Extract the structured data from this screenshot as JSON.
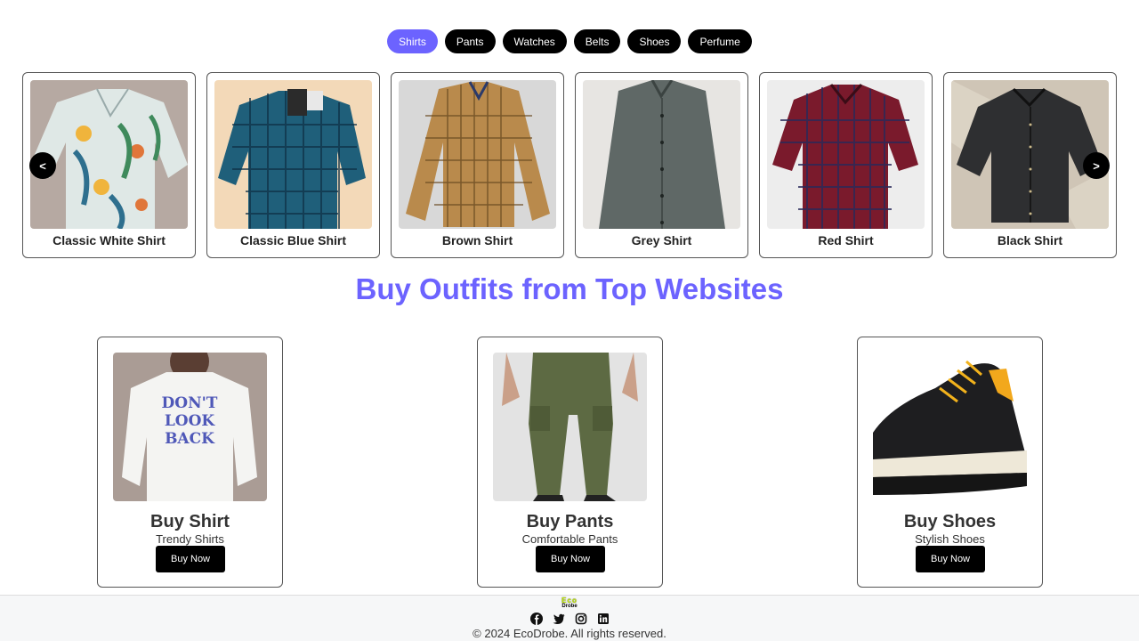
{
  "categories": {
    "items": [
      "Shirts",
      "Pants",
      "Watches",
      "Belts",
      "Shoes",
      "Perfume"
    ],
    "active": "Shirts"
  },
  "carousel": {
    "prev_label": "<",
    "next_label": ">",
    "items": [
      {
        "name": "Classic White Shirt"
      },
      {
        "name": "Classic Blue Shirt"
      },
      {
        "name": "Brown Shirt"
      },
      {
        "name": "Grey Shirt"
      },
      {
        "name": "Red Shirt"
      },
      {
        "name": "Black Shirt"
      }
    ]
  },
  "section": {
    "title": "Buy Outfits from Top Websites"
  },
  "shop": [
    {
      "title": "Buy Shirt",
      "subtitle": "Trendy Shirts",
      "button": "Buy Now",
      "print_text": "DON'T LOOK BACK"
    },
    {
      "title": "Buy Pants",
      "subtitle": "Comfortable Pants",
      "button": "Buy Now"
    },
    {
      "title": "Buy Shoes",
      "subtitle": "Stylish Shoes",
      "button": "Buy Now"
    }
  ],
  "footer": {
    "logo_line1": "Eco",
    "logo_line2": "Drobe",
    "social": [
      "facebook-icon",
      "twitter-icon",
      "instagram-icon",
      "linkedin-icon"
    ],
    "copyright": "© 2024 EcoDrobe. All rights reserved."
  },
  "colors": {
    "accent": "#6c63ff",
    "button": "#000000",
    "logo": "#c6f000"
  }
}
